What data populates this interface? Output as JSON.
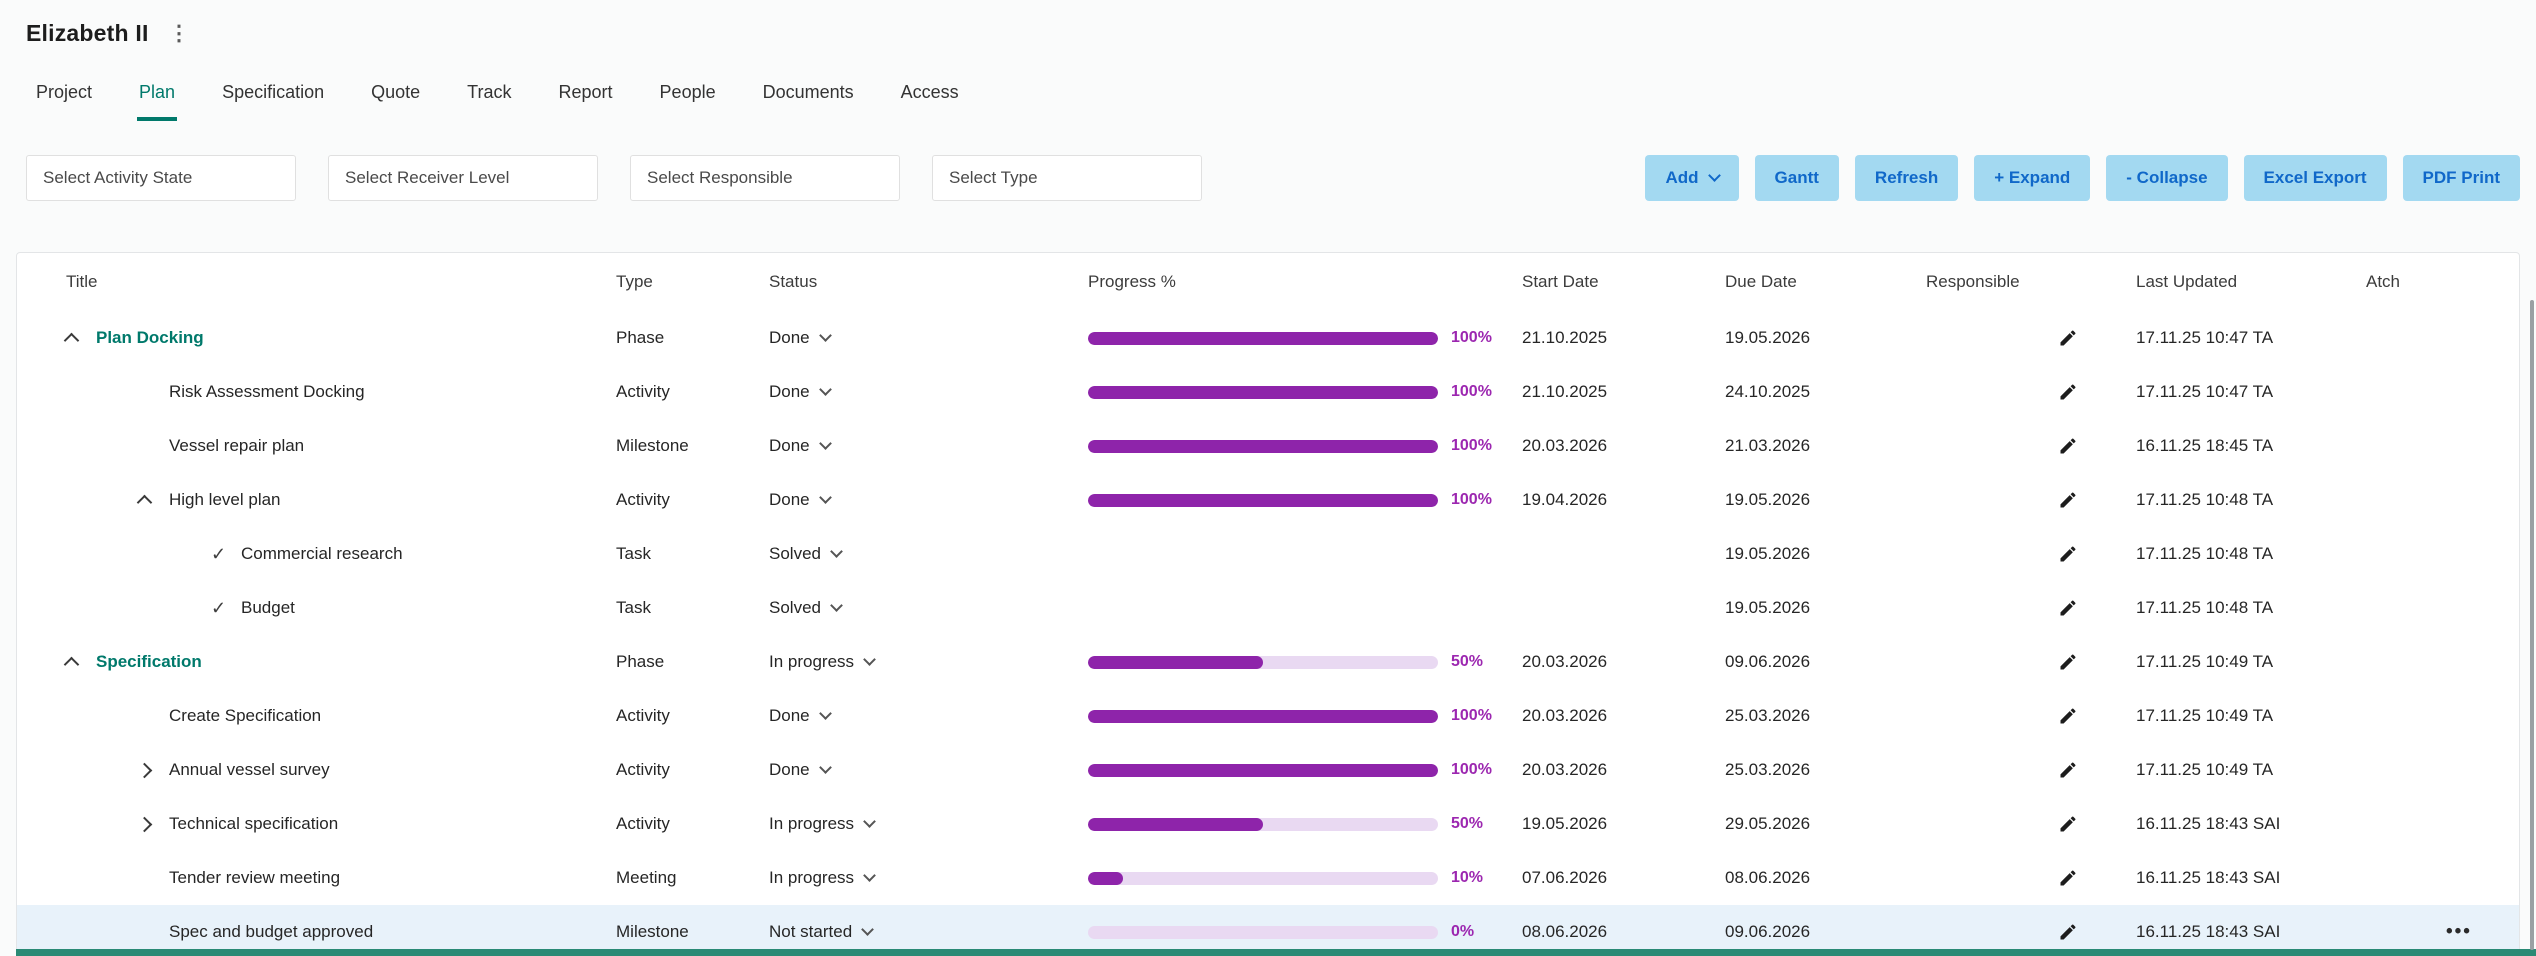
{
  "header": {
    "title": "Elizabeth II"
  },
  "icons": {
    "kebab": "⋮",
    "check": "✓",
    "more": "•••"
  },
  "tabs": [
    {
      "label": "Project",
      "active": false
    },
    {
      "label": "Plan",
      "active": true
    },
    {
      "label": "Specification",
      "active": false
    },
    {
      "label": "Quote",
      "active": false
    },
    {
      "label": "Track",
      "active": false
    },
    {
      "label": "Report",
      "active": false
    },
    {
      "label": "People",
      "active": false
    },
    {
      "label": "Documents",
      "active": false
    },
    {
      "label": "Access",
      "active": false
    }
  ],
  "filters": [
    {
      "name": "activity-state",
      "placeholder": "Select Activity State"
    },
    {
      "name": "receiver-level",
      "placeholder": "Select Receiver Level"
    },
    {
      "name": "responsible",
      "placeholder": "Select Responsible"
    },
    {
      "name": "type",
      "placeholder": "Select Type"
    }
  ],
  "toolbar": [
    {
      "name": "add",
      "label": "Add",
      "chevron": true
    },
    {
      "name": "gantt",
      "label": "Gantt"
    },
    {
      "name": "refresh",
      "label": "Refresh"
    },
    {
      "name": "expand",
      "label": "+ Expand"
    },
    {
      "name": "collapse",
      "label": "- Collapse"
    },
    {
      "name": "excel-export",
      "label": "Excel Export"
    },
    {
      "name": "pdf-print",
      "label": "PDF Print"
    }
  ],
  "table": {
    "columns": [
      "Title",
      "Type",
      "Status",
      "Progress %",
      "Start Date",
      "Due Date",
      "Responsible",
      "Last Updated",
      "Atch"
    ],
    "rows": [
      {
        "title": "Plan Docking",
        "indent": 0,
        "marker": "collapse",
        "phase": true,
        "type": "Phase",
        "status": "Done",
        "progress": 100,
        "start": "21.10.2025",
        "due": "19.05.2026",
        "updated": "17.11.25 10:47 TA",
        "highlighted": false,
        "more": false
      },
      {
        "title": "Risk Assessment Docking",
        "indent": 1,
        "marker": null,
        "phase": false,
        "type": "Activity",
        "status": "Done",
        "progress": 100,
        "start": "21.10.2025",
        "due": "24.10.2025",
        "updated": "17.11.25 10:47 TA",
        "highlighted": false,
        "more": false
      },
      {
        "title": "Vessel repair plan",
        "indent": 1,
        "marker": null,
        "phase": false,
        "type": "Milestone",
        "status": "Done",
        "progress": 100,
        "start": "20.03.2026",
        "due": "21.03.2026",
        "updated": "16.11.25 18:45 TA",
        "highlighted": false,
        "more": false
      },
      {
        "title": "High level plan",
        "indent": 1,
        "marker": "collapse",
        "phase": false,
        "type": "Activity",
        "status": "Done",
        "progress": 100,
        "start": "19.04.2026",
        "due": "19.05.2026",
        "updated": "17.11.25 10:48 TA",
        "highlighted": false,
        "more": false
      },
      {
        "title": "Commercial research",
        "indent": 2,
        "marker": "check",
        "phase": false,
        "type": "Task",
        "status": "Solved",
        "progress": null,
        "start": "",
        "due": "19.05.2026",
        "updated": "17.11.25 10:48 TA",
        "highlighted": false,
        "more": false
      },
      {
        "title": "Budget",
        "indent": 2,
        "marker": "check",
        "phase": false,
        "type": "Task",
        "status": "Solved",
        "progress": null,
        "start": "",
        "due": "19.05.2026",
        "updated": "17.11.25 10:48 TA",
        "highlighted": false,
        "more": false
      },
      {
        "title": "Specification",
        "indent": 0,
        "marker": "collapse",
        "phase": true,
        "type": "Phase",
        "status": "In progress",
        "progress": 50,
        "start": "20.03.2026",
        "due": "09.06.2026",
        "updated": "17.11.25 10:49 TA",
        "highlighted": false,
        "more": false
      },
      {
        "title": "Create Specification",
        "indent": 1,
        "marker": null,
        "phase": false,
        "type": "Activity",
        "status": "Done",
        "progress": 100,
        "start": "20.03.2026",
        "due": "25.03.2026",
        "updated": "17.11.25 10:49 TA",
        "highlighted": false,
        "more": false
      },
      {
        "title": "Annual vessel survey",
        "indent": 1,
        "marker": "expand",
        "phase": false,
        "type": "Activity",
        "status": "Done",
        "progress": 100,
        "start": "20.03.2026",
        "due": "25.03.2026",
        "updated": "17.11.25 10:49 TA",
        "highlighted": false,
        "more": false
      },
      {
        "title": "Technical specification",
        "indent": 1,
        "marker": "expand",
        "phase": false,
        "type": "Activity",
        "status": "In progress",
        "progress": 50,
        "start": "19.05.2026",
        "due": "29.05.2026",
        "updated": "16.11.25 18:43 SAI",
        "highlighted": false,
        "more": false
      },
      {
        "title": "Tender review meeting",
        "indent": 1,
        "marker": null,
        "phase": false,
        "type": "Meeting",
        "status": "In progress",
        "progress": 10,
        "start": "07.06.2026",
        "due": "08.06.2026",
        "updated": "16.11.25 18:43 SAI",
        "highlighted": false,
        "more": false
      },
      {
        "title": "Spec and budget approved",
        "indent": 1,
        "marker": null,
        "phase": false,
        "type": "Milestone",
        "status": "Not started",
        "progress": 0,
        "start": "08.06.2026",
        "due": "09.06.2026",
        "updated": "16.11.25 18:43 SAI",
        "highlighted": true,
        "more": true
      }
    ]
  },
  "colors": {
    "accent_teal": "#00796b",
    "progress_fill": "#8e24aa",
    "progress_track": "#e9d9f2",
    "percent_text": "#9c27b0",
    "button_bg": "#a3d9f1",
    "button_text": "#1068c9",
    "highlight_row": "#e8f2fa",
    "bottom_bar": "#2a8a75"
  }
}
